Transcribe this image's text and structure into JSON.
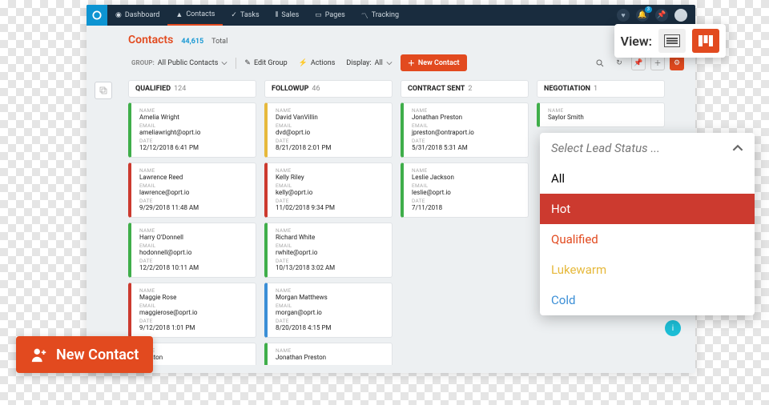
{
  "nav": {
    "items": [
      {
        "label": "Dashboard"
      },
      {
        "label": "Contacts"
      },
      {
        "label": "Tasks"
      },
      {
        "label": "Sales"
      },
      {
        "label": "Pages"
      },
      {
        "label": "Tracking"
      }
    ],
    "notif_count": "3"
  },
  "page": {
    "title": "Contacts",
    "total_count": "44,615",
    "total_label": "Total"
  },
  "toolbar": {
    "group_label": "GROUP:",
    "group_value": "All Public Contacts",
    "edit_group": "Edit Group",
    "actions": "Actions",
    "display_label": "Display:",
    "display_value": "All",
    "new_contact": "New Contact"
  },
  "columns": [
    {
      "title": "QUALIFIED",
      "count": "124",
      "cards": [
        {
          "color": "bl-green",
          "name": "Amelia Wright",
          "email": "ameliawright@oprt.io",
          "date": "12/12/2018 6:41 PM"
        },
        {
          "color": "bl-red",
          "name": "Lawrence Reed",
          "email": "lawrence@oprt.io",
          "date": "9/29/2018 11:48 AM"
        },
        {
          "color": "bl-green",
          "name": "Harry O'Donnell",
          "email": "hodonnell@oprt.io",
          "date": "12/2/2018 10:11 AM"
        },
        {
          "color": "bl-red",
          "name": "Maggie Rose",
          "email": "maggierose@oprt.io",
          "date": "9/12/2018 1:01 PM"
        },
        {
          "color": "bl-yellow",
          "name": "Winston",
          "email": "",
          "date": ""
        }
      ]
    },
    {
      "title": "FOLLOWUP",
      "count": "46",
      "cards": [
        {
          "color": "bl-yellow",
          "name": "David VanVillin",
          "email": "dvd@oprt.io",
          "date": "8/21/2018 2:01 PM"
        },
        {
          "color": "bl-red",
          "name": "Kelly Riley",
          "email": "kelly@oprt.io",
          "date": "11/02/2018 9:34 PM"
        },
        {
          "color": "bl-green",
          "name": "Richard White",
          "email": "rwhite@oprt.io",
          "date": "10/13/2018 3:02 AM"
        },
        {
          "color": "bl-blue",
          "name": "Morgan Matthews",
          "email": "morgan@oprt.io",
          "date": "8/20/2018 4:15 PM"
        },
        {
          "color": "bl-green",
          "name": "Jonathan Preston",
          "email": "",
          "date": ""
        }
      ]
    },
    {
      "title": "CONTRACT SENT",
      "count": "2",
      "cards": [
        {
          "color": "bl-green",
          "name": "Jonathan Preston",
          "email": "jpreston@ontraport.io",
          "date": "5/31/2018 5:31 AM"
        },
        {
          "color": "bl-green",
          "name": "Leslie Jackson",
          "email": "leslie@oprt.io",
          "date": "7/11/2018"
        }
      ]
    },
    {
      "title": "NEGOTIATION",
      "count": "1",
      "cards": [
        {
          "color": "bl-green",
          "name": "Saylor Smith",
          "email": "",
          "date": ""
        }
      ]
    }
  ],
  "labels": {
    "name": "NAME",
    "email": "EMAIL",
    "date": "DATE"
  },
  "view_toggle": {
    "label": "View:"
  },
  "lead_dropdown": {
    "placeholder": "Select Lead Status ...",
    "items": [
      "All",
      "Hot",
      "Qualified",
      "Lukewarm",
      "Cold"
    ]
  },
  "cta": {
    "new_contact": "New Contact"
  }
}
